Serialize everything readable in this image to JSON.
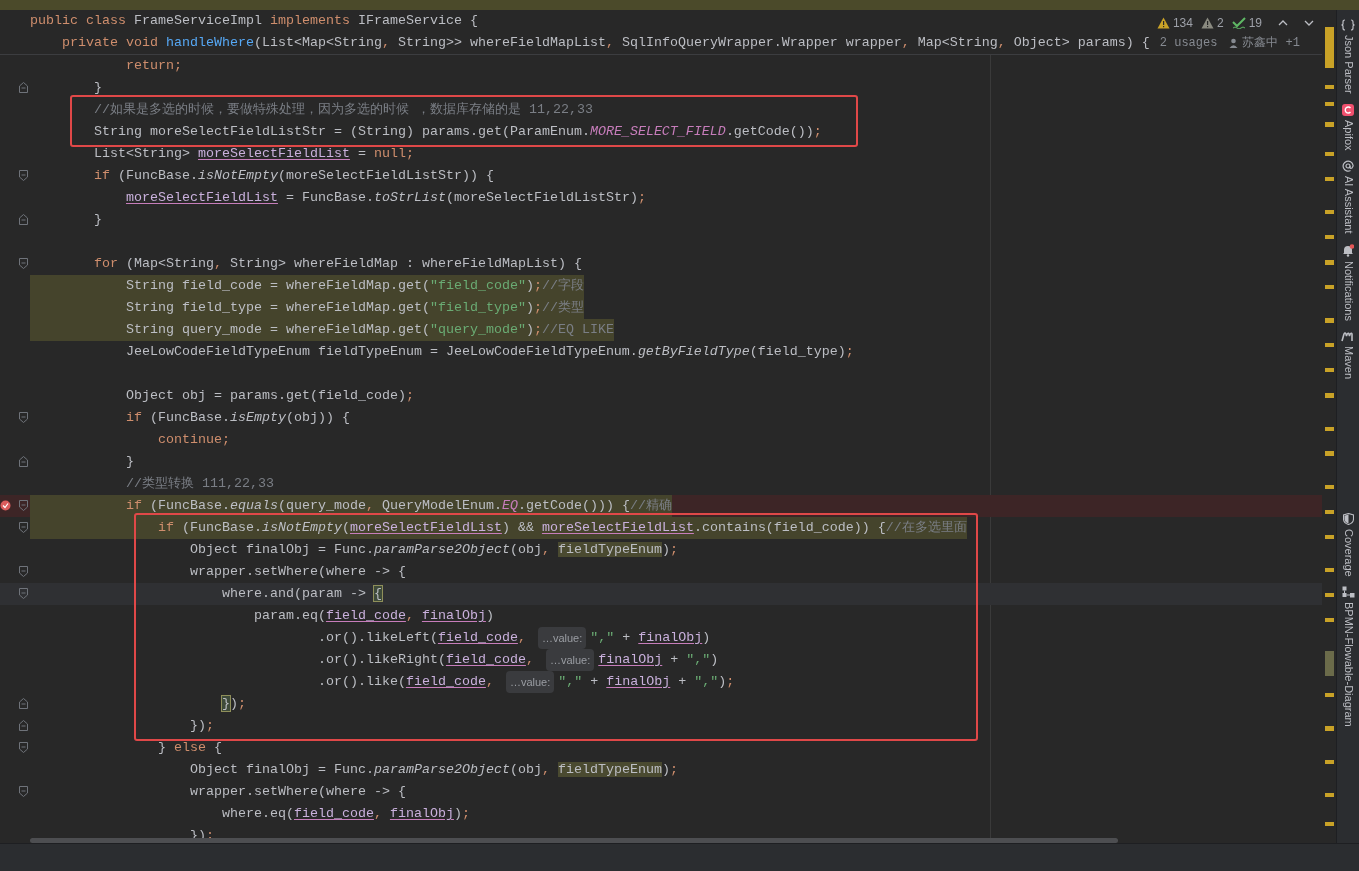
{
  "header_lines": [
    {
      "tokens": [
        {
          "text": "public class ",
          "kind": "keyword"
        },
        {
          "text": "FrameServiceImpl ",
          "kind": "plain"
        },
        {
          "text": "implements ",
          "kind": "keyword"
        },
        {
          "text": "IFrameService {",
          "kind": "plain"
        }
      ]
    },
    {
      "tokens": [
        {
          "text": "    private void ",
          "kind": "keyword"
        },
        {
          "text": "handleWhere",
          "kind": "declaration"
        },
        {
          "text": "(List<Map<String",
          "kind": "plain"
        },
        {
          "text": ", ",
          "kind": "punct"
        },
        {
          "text": "String>> whereFieldMapList",
          "kind": "plain"
        },
        {
          "text": ", ",
          "kind": "punct"
        },
        {
          "text": "SqlInfoQueryWrapper.Wrapper wrapper",
          "kind": "plain"
        },
        {
          "text": ", ",
          "kind": "punct"
        },
        {
          "text": "Map<String",
          "kind": "plain"
        },
        {
          "text": ", ",
          "kind": "punct"
        },
        {
          "text": "Object> params) {",
          "kind": "plain"
        }
      ],
      "usages": "2 usages",
      "author": "苏鑫中 +1"
    }
  ],
  "inspections": [
    {
      "kind": "warning",
      "count": "134"
    },
    {
      "kind": "weak_warning",
      "count": "2"
    },
    {
      "kind": "typo",
      "count": "19"
    }
  ],
  "segments": [
    {
      "boxed": false,
      "lines": [
        {
          "kind": "code",
          "match": false,
          "error": false,
          "current": false,
          "tokens": [
            {
              "text": "            return",
              "kind": "keyword"
            },
            {
              "text": ";",
              "kind": "punct"
            }
          ]
        },
        {
          "kind": "fold_end",
          "match": false,
          "error": false,
          "current": false,
          "tokens": [
            {
              "text": "        }",
              "kind": "plain"
            }
          ]
        }
      ]
    },
    {
      "boxed": true,
      "lines": [
        {
          "kind": "code",
          "match": false,
          "error": false,
          "current": false,
          "tokens": [
            {
              "text": "        //如果是多选的时候，要做特殊处理，因为多选的时候 ，数据库存储的是 11,22,33",
              "kind": "comment"
            }
          ]
        },
        {
          "kind": "code",
          "match": false,
          "error": false,
          "current": false,
          "tokens": [
            {
              "text": "        String moreSelectFieldListStr = (String) params.get(ParamEnum.",
              "kind": "plain"
            },
            {
              "text": "MORE_SELECT_FIELD",
              "kind": "constant"
            },
            {
              "text": ".getCode())",
              "kind": "plain"
            },
            {
              "text": ";",
              "kind": "punct"
            }
          ]
        }
      ]
    },
    {
      "boxed": false,
      "lines": [
        {
          "kind": "code",
          "match": false,
          "error": false,
          "current": false,
          "tokens": [
            {
              "text": "        List<String> ",
              "kind": "plain"
            },
            {
              "text": "moreSelectFieldList",
              "kind": "reassigned"
            },
            {
              "text": " = ",
              "kind": "plain"
            },
            {
              "text": "null",
              "kind": "keyword"
            },
            {
              "text": ";",
              "kind": "punct"
            }
          ]
        },
        {
          "kind": "fold_start",
          "match": false,
          "error": false,
          "current": false,
          "tokens": [
            {
              "text": "        if ",
              "kind": "keyword"
            },
            {
              "text": "(FuncBase.",
              "kind": "plain"
            },
            {
              "text": "isNotEmpty",
              "kind": "static_call"
            },
            {
              "text": "(moreSelectFieldListStr)) {",
              "kind": "plain"
            }
          ]
        },
        {
          "kind": "code",
          "match": false,
          "error": false,
          "current": false,
          "tokens": [
            {
              "text": "            moreSelectFieldList",
              "kind": "reassigned"
            },
            {
              "text": " = FuncBase.",
              "kind": "plain"
            },
            {
              "text": "toStrList",
              "kind": "static_call"
            },
            {
              "text": "(moreSelectFieldListStr)",
              "kind": "plain"
            },
            {
              "text": ";",
              "kind": "punct"
            }
          ]
        },
        {
          "kind": "fold_end",
          "match": false,
          "error": false,
          "current": false,
          "tokens": [
            {
              "text": "        }",
              "kind": "plain"
            }
          ]
        },
        {
          "kind": "blank"
        },
        {
          "kind": "fold_start",
          "match": false,
          "error": false,
          "current": false,
          "tokens": [
            {
              "text": "        for ",
              "kind": "keyword"
            },
            {
              "text": "(Map<String",
              "kind": "plain"
            },
            {
              "text": ", ",
              "kind": "punct"
            },
            {
              "text": "String> whereFieldMap : whereFieldMapList) {",
              "kind": "plain"
            }
          ]
        },
        {
          "kind": "code",
          "match": true,
          "error": false,
          "current": false,
          "tokens": [
            {
              "text": "            String field_code = whereFieldMap.get(",
              "kind": "plain"
            },
            {
              "text": "\"field_code\"",
              "kind": "string"
            },
            {
              "text": ")",
              "kind": "plain"
            },
            {
              "text": ";",
              "kind": "punct"
            },
            {
              "text": "//字段",
              "kind": "comment"
            }
          ]
        },
        {
          "kind": "code",
          "match": true,
          "error": false,
          "current": false,
          "tokens": [
            {
              "text": "            String field_type = whereFieldMap.get(",
              "kind": "plain"
            },
            {
              "text": "\"field_type\"",
              "kind": "string"
            },
            {
              "text": ")",
              "kind": "plain"
            },
            {
              "text": ";",
              "kind": "punct"
            },
            {
              "text": "//类型",
              "kind": "comment"
            }
          ]
        },
        {
          "kind": "code",
          "match": true,
          "error": false,
          "current": false,
          "tokens": [
            {
              "text": "            String query_mode = whereFieldMap.get(",
              "kind": "plain"
            },
            {
              "text": "\"query_mode\"",
              "kind": "string"
            },
            {
              "text": ")",
              "kind": "plain"
            },
            {
              "text": ";",
              "kind": "punct"
            },
            {
              "text": "//EQ LIKE",
              "kind": "comment"
            }
          ]
        },
        {
          "kind": "code",
          "match": false,
          "error": false,
          "current": false,
          "tokens": [
            {
              "text": "            JeeLowCodeFieldTypeEnum fieldTypeEnum = JeeLowCodeFieldTypeEnum.",
              "kind": "plain"
            },
            {
              "text": "getByFieldType",
              "kind": "static_call"
            },
            {
              "text": "(field_type)",
              "kind": "plain"
            },
            {
              "text": ";",
              "kind": "punct"
            }
          ]
        },
        {
          "kind": "blank"
        },
        {
          "kind": "code",
          "match": false,
          "error": false,
          "current": false,
          "tokens": [
            {
              "text": "            Object obj = params.get(field_code)",
              "kind": "plain"
            },
            {
              "text": ";",
              "kind": "punct"
            }
          ]
        },
        {
          "kind": "fold_start",
          "match": false,
          "error": false,
          "current": false,
          "tokens": [
            {
              "text": "            if ",
              "kind": "keyword"
            },
            {
              "text": "(FuncBase.",
              "kind": "plain"
            },
            {
              "text": "isEmpty",
              "kind": "static_call"
            },
            {
              "text": "(obj)) {",
              "kind": "plain"
            }
          ]
        },
        {
          "kind": "code",
          "match": false,
          "error": false,
          "current": false,
          "tokens": [
            {
              "text": "                continue",
              "kind": "keyword"
            },
            {
              "text": ";",
              "kind": "punct"
            }
          ]
        },
        {
          "kind": "fold_end",
          "match": false,
          "error": false,
          "current": false,
          "tokens": [
            {
              "text": "            }",
              "kind": "plain"
            }
          ]
        },
        {
          "kind": "code",
          "match": false,
          "error": false,
          "current": false,
          "tokens": [
            {
              "text": "            //类型转换 111,22,33",
              "kind": "comment"
            }
          ]
        },
        {
          "kind": "fold_start",
          "match": true,
          "error": true,
          "current": false,
          "tokens": [
            {
              "text": "            if ",
              "kind": "keyword"
            },
            {
              "text": "(FuncBase.",
              "kind": "plain"
            },
            {
              "text": "equals",
              "kind": "static_call"
            },
            {
              "text": "(query_mode",
              "kind": "plain"
            },
            {
              "text": ", ",
              "kind": "punct"
            },
            {
              "text": "QueryModelEnum.",
              "kind": "plain"
            },
            {
              "text": "EQ",
              "kind": "constant"
            },
            {
              "text": ".getCode())) {",
              "kind": "plain"
            },
            {
              "text": "//精确",
              "kind": "comment"
            }
          ]
        }
      ]
    },
    {
      "boxed": true,
      "lines": [
        {
          "kind": "fold_start",
          "match": true,
          "error": false,
          "current": false,
          "tokens": [
            {
              "text": "                if ",
              "kind": "keyword"
            },
            {
              "text": "(FuncBase.",
              "kind": "plain"
            },
            {
              "text": "isNotEmpty",
              "kind": "static_call"
            },
            {
              "text": "(",
              "kind": "plain"
            },
            {
              "text": "moreSelectFieldList",
              "kind": "reassigned"
            },
            {
              "text": ") && ",
              "kind": "plain"
            },
            {
              "text": "moreSelectFieldList",
              "kind": "reassigned"
            },
            {
              "text": ".contains(field_code)) {",
              "kind": "plain"
            },
            {
              "text": "//在多选里面",
              "kind": "comment"
            }
          ]
        },
        {
          "kind": "code",
          "match": false,
          "error": false,
          "current": false,
          "tokens": [
            {
              "text": "                    Object finalObj = Func.",
              "kind": "plain"
            },
            {
              "text": "paramParse2Object",
              "kind": "static_call"
            },
            {
              "text": "(obj",
              "kind": "plain"
            },
            {
              "text": ", ",
              "kind": "punct"
            },
            {
              "text": "fieldTypeEnum",
              "kind": "marked"
            },
            {
              "text": ")",
              "kind": "plain"
            },
            {
              "text": ";",
              "kind": "punct"
            }
          ]
        },
        {
          "kind": "fold_start",
          "match": false,
          "error": false,
          "current": false,
          "tokens": [
            {
              "text": "                    wrapper.setWhere(where -> {",
              "kind": "plain"
            }
          ]
        },
        {
          "kind": "fold_start",
          "match": false,
          "error": false,
          "current": true,
          "tokens": [
            {
              "text": "                        where.and(param -> ",
              "kind": "plain"
            },
            {
              "text": "{",
              "kind": "brace"
            }
          ]
        },
        {
          "kind": "code",
          "match": false,
          "error": false,
          "current": false,
          "tokens": [
            {
              "text": "                            param.eq(",
              "kind": "plain"
            },
            {
              "text": "field_code",
              "kind": "reassigned"
            },
            {
              "text": ", ",
              "kind": "punct"
            },
            {
              "text": "finalObj",
              "kind": "reassigned"
            },
            {
              "text": ")",
              "kind": "plain"
            }
          ]
        },
        {
          "kind": "code",
          "match": false,
          "error": false,
          "current": false,
          "tokens": [
            {
              "text": "                                    .or().likeLeft(",
              "kind": "plain"
            },
            {
              "text": "field_code",
              "kind": "reassigned"
            },
            {
              "text": ", ",
              "kind": "punct"
            },
            {
              "text": "…value:",
              "kind": "hint"
            },
            {
              "text": "\",\"",
              "kind": "string"
            },
            {
              "text": " + ",
              "kind": "plain"
            },
            {
              "text": "finalObj",
              "kind": "reassigned"
            },
            {
              "text": ")",
              "kind": "plain"
            }
          ]
        },
        {
          "kind": "code",
          "match": false,
          "error": false,
          "current": false,
          "tokens": [
            {
              "text": "                                    .or().likeRight(",
              "kind": "plain"
            },
            {
              "text": "field_code",
              "kind": "reassigned"
            },
            {
              "text": ", ",
              "kind": "punct"
            },
            {
              "text": "…value:",
              "kind": "hint"
            },
            {
              "text": "finalObj",
              "kind": "reassigned"
            },
            {
              "text": " + ",
              "kind": "plain"
            },
            {
              "text": "\",\"",
              "kind": "string"
            },
            {
              "text": ")",
              "kind": "plain"
            }
          ]
        },
        {
          "kind": "code",
          "match": false,
          "error": false,
          "current": false,
          "tokens": [
            {
              "text": "                                    .or().like(",
              "kind": "plain"
            },
            {
              "text": "field_code",
              "kind": "reassigned"
            },
            {
              "text": ", ",
              "kind": "punct"
            },
            {
              "text": "…value:",
              "kind": "hint"
            },
            {
              "text": "\",\"",
              "kind": "string"
            },
            {
              "text": " + ",
              "kind": "plain"
            },
            {
              "text": "finalObj",
              "kind": "reassigned"
            },
            {
              "text": " + ",
              "kind": "plain"
            },
            {
              "text": "\",\"",
              "kind": "string"
            },
            {
              "text": ")",
              "kind": "plain"
            },
            {
              "text": ";",
              "kind": "punct"
            }
          ]
        },
        {
          "kind": "fold_end",
          "match": false,
          "error": false,
          "current": false,
          "tokens": [
            {
              "text": "                        }",
              "kind": "brace"
            },
            {
              "text": ")",
              "kind": "plain"
            },
            {
              "text": ";",
              "kind": "punct"
            }
          ]
        },
        {
          "kind": "fold_end",
          "match": false,
          "error": false,
          "current": false,
          "tokens": [
            {
              "text": "                    })",
              "kind": "plain"
            },
            {
              "text": ";",
              "kind": "punct"
            }
          ]
        }
      ]
    },
    {
      "boxed": false,
      "lines": [
        {
          "kind": "fold_start",
          "match": false,
          "error": false,
          "current": false,
          "tokens": [
            {
              "text": "                } ",
              "kind": "plain"
            },
            {
              "text": "else ",
              "kind": "keyword"
            },
            {
              "text": "{",
              "kind": "plain"
            }
          ]
        },
        {
          "kind": "code",
          "match": false,
          "error": false,
          "current": false,
          "tokens": [
            {
              "text": "                    Object finalObj = Func.",
              "kind": "plain"
            },
            {
              "text": "paramParse2Object",
              "kind": "static_call"
            },
            {
              "text": "(obj",
              "kind": "plain"
            },
            {
              "text": ", ",
              "kind": "punct"
            },
            {
              "text": "fieldTypeEnum",
              "kind": "marked"
            },
            {
              "text": ")",
              "kind": "plain"
            },
            {
              "text": ";",
              "kind": "punct"
            }
          ]
        },
        {
          "kind": "fold_start",
          "match": false,
          "error": false,
          "current": false,
          "tokens": [
            {
              "text": "                    wrapper.setWhere(where -> {",
              "kind": "plain"
            }
          ]
        },
        {
          "kind": "code",
          "match": false,
          "error": false,
          "current": false,
          "tokens": [
            {
              "text": "                        where.eq(",
              "kind": "plain"
            },
            {
              "text": "field_code",
              "kind": "reassigned"
            },
            {
              "text": ", ",
              "kind": "punct"
            },
            {
              "text": "finalObj",
              "kind": "reassigned"
            },
            {
              "text": ")",
              "kind": "plain"
            },
            {
              "text": ";",
              "kind": "punct"
            }
          ]
        },
        {
          "kind": "code",
          "match": false,
          "error": false,
          "current": false,
          "tokens": [
            {
              "text": "                    })",
              "kind": "plain"
            },
            {
              "text": ";",
              "kind": "punct"
            }
          ]
        }
      ]
    }
  ],
  "tool_windows_top": [
    {
      "label": "Json Parser",
      "kind": "braces"
    },
    {
      "label": "Apifox",
      "kind": "apifox"
    },
    {
      "label": "AI Assistant",
      "kind": "at"
    },
    {
      "label": "Notifications",
      "kind": "bell"
    },
    {
      "label": "Maven",
      "kind": "maven"
    }
  ],
  "tool_windows_bottom": [
    {
      "label": "Coverage",
      "kind": "shield"
    },
    {
      "label": "BPMN-Flowable-Diagram",
      "kind": "diagram"
    }
  ]
}
